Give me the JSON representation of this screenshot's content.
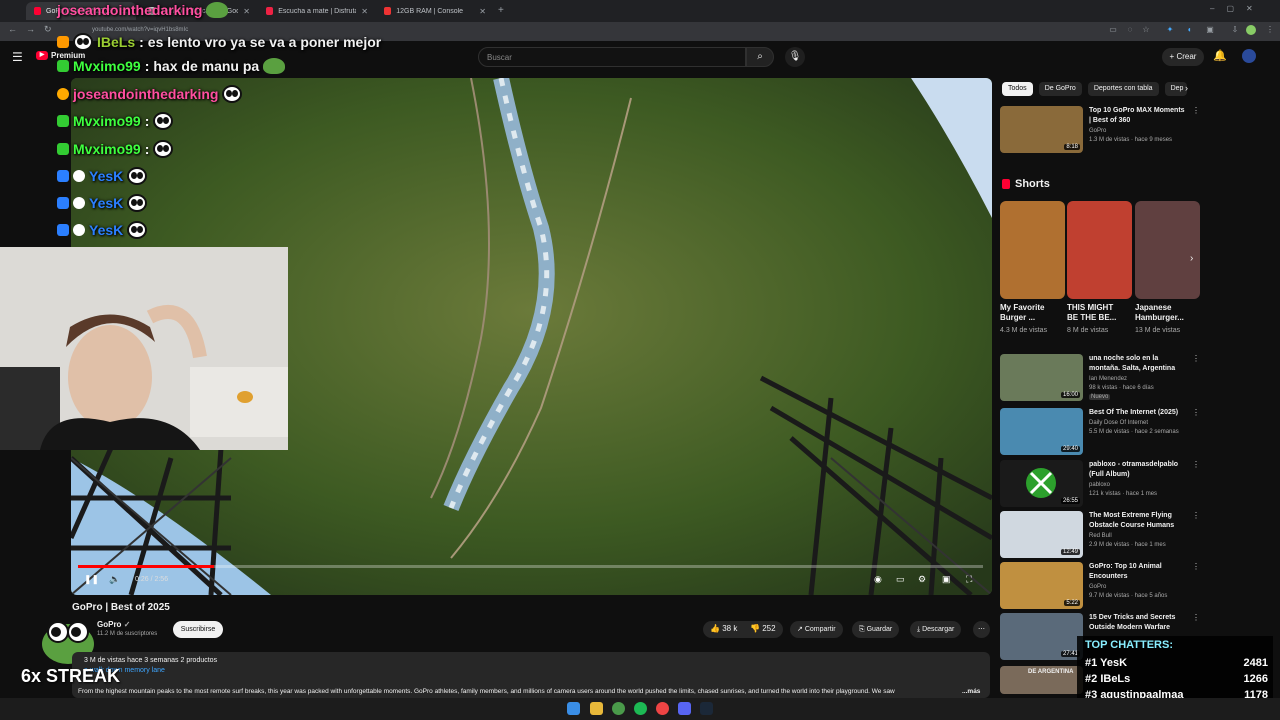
{
  "browser": {
    "tabs": [
      {
        "label": "GoPro | Best of 2025 - YouTube",
        "active": true
      },
      {
        "label": "Zambol - Buscar con Google",
        "active": false
      },
      {
        "label": "Escucha a mate | Disfruta de la",
        "active": false
      },
      {
        "label": "12GB RAM | Console",
        "active": false
      }
    ],
    "url": "youtube.com/watch?v=iqvH1bs8mIc"
  },
  "youtube": {
    "logo": "Premium",
    "search_placeholder": "Buscar",
    "create_label": "Crear"
  },
  "chat_overlay": [
    {
      "user": "joseandointhedarking",
      "message": "",
      "color": "#ff4fa0"
    },
    {
      "user": "IBeLs",
      "message": "es lento vro ya se va a poner mejor",
      "color": "#9acd32"
    },
    {
      "user": "Mvximo99",
      "message": "hax de manu pa",
      "color": "#3fff3f"
    },
    {
      "user": "joseandointhedarking",
      "message": "",
      "color": "#ff4fa0"
    },
    {
      "user": "Mvximo99",
      "message": "",
      "color": "#3fff3f"
    },
    {
      "user": "Mvximo99",
      "message": "",
      "color": "#3fff3f"
    },
    {
      "user": "YesK",
      "message": "",
      "color": "#2b7fff"
    },
    {
      "user": "YesK",
      "message": "",
      "color": "#2b7fff"
    },
    {
      "user": "YesK",
      "message": "",
      "color": "#2b7fff"
    }
  ],
  "player": {
    "current_time": "0:26 / 2:56",
    "progress": 0.15
  },
  "video": {
    "title": "GoPro | Best of 2025",
    "channel": "GoPro",
    "subscribers": "11.2 M de suscriptores",
    "subscribe_label": "Suscribirse",
    "likes": "38 k",
    "dislikes": "252",
    "share_label": "Compartir",
    "save_label": "Guardar",
    "download_label": "Descargar",
    "stats": "3 M de vistas  hace 3 semanas  2 productos",
    "hashtag": "a walk down memory lane",
    "description": "From the highest mountain peaks to the most remote surf breaks, this year was packed with unforgettable moments. GoPro athletes, family members, and millions of camera users around the world pushed the limits, chased sunrises, and turned the world into their playground. We saw",
    "more": "...más"
  },
  "sidebar": {
    "chips": [
      "Todos",
      "De GoPro",
      "Deportes con tabla",
      "Dep"
    ],
    "videos": [
      {
        "title": "Top 10 GoPro MAX Moments | Best of 360",
        "channel": "GoPro",
        "meta": "1.3 M de vistas · hace 9 meses",
        "duration": "8:18",
        "color": "#8a6a3a"
      },
      {
        "title": "una noche solo en la montaña. Salta, Argentina",
        "channel": "Ian Menendez",
        "meta": "98 k vistas · hace 6 días",
        "badge": "Nuevo",
        "duration": "16:00",
        "color": "#6a7a5a"
      },
      {
        "title": "Best Of The Internet (2025)",
        "channel": "Daily Dose Of Internet",
        "meta": "5.5 M de vistas · hace 2 semanas",
        "duration": "29:40",
        "color": "#4a8ab0"
      },
      {
        "title": "pabloxo - otramasdelpablo (Full Album)",
        "channel": "pabloxo",
        "meta": "121 k vistas · hace 1 mes",
        "duration": "26:55",
        "color": "#1a1a1a"
      },
      {
        "title": "The Most Extreme Flying Obstacle Course Humans Hav...",
        "channel": "Red Bull",
        "meta": "2.9 M de vistas · hace 1 mes",
        "duration": "12:49",
        "color": "#d0d8e0"
      },
      {
        "title": "GoPro: Top 10 Animal Encounters",
        "channel": "GoPro",
        "meta": "9.7 M de vistas · hace 5 años",
        "duration": "5:22",
        "color": "#c09040"
      },
      {
        "title": "15 Dev Tricks and Secrets Outside Modern Warfare",
        "channel": "",
        "meta": "",
        "duration": "27:41",
        "color": "#5a6a7a"
      }
    ],
    "shorts_heading": "Shorts",
    "shorts": [
      {
        "title": "My Favorite Burger ...",
        "views": "4.3 M de vistas",
        "color": "#b07030"
      },
      {
        "title": "THIS MIGHT BE THE BE...",
        "views": "8 M de vistas",
        "color": "#c04030"
      },
      {
        "title": "Japanese Hamburger...",
        "views": "13 M de vistas",
        "color": "#604040"
      }
    ],
    "bottom_strip_label": "DE ARGENTINA"
  },
  "stream_overlay": {
    "streak": "6x STREAK",
    "top_chatters_title": "TOP CHATTERS:",
    "top_chatters": [
      {
        "rank": "#1",
        "name": "YesK",
        "count": "2481"
      },
      {
        "rank": "#2",
        "name": "IBeLs",
        "count": "1266"
      },
      {
        "rank": "#3",
        "name": "agustinpaalmaa",
        "count": "1178"
      }
    ]
  }
}
